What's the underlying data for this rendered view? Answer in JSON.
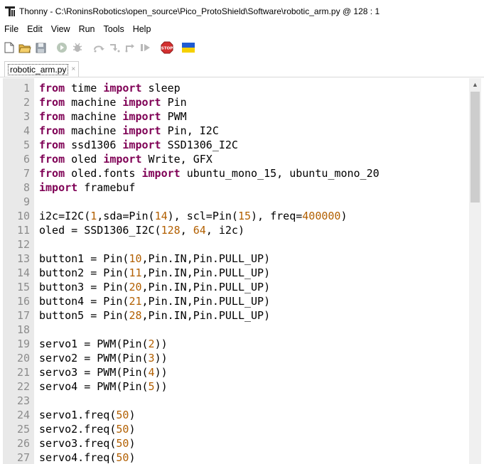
{
  "window": {
    "title": "Thonny  -  C:\\RoninsRobotics\\open_source\\Pico_ProtoShield\\Software\\robotic_arm.py  @  128 : 1"
  },
  "menu": [
    "File",
    "Edit",
    "View",
    "Run",
    "Tools",
    "Help"
  ],
  "toolbar": {
    "icons": [
      "new-file-icon",
      "open-folder-icon",
      "save-icon",
      "run-icon",
      "debug-icon",
      "step-over-icon",
      "step-into-icon",
      "step-out-icon",
      "resume-icon",
      "stop-icon",
      "ukraine-flag-icon"
    ],
    "stop_label": "STOP",
    "colors": {
      "stop": "#d32f2f",
      "flag_blue": "#1f5bd1",
      "flag_yellow": "#f5d000"
    }
  },
  "editor": {
    "tab_label": "robotic_arm.py",
    "tab_close": "×",
    "lines": [
      {
        "n": "1",
        "parts": [
          [
            "kw",
            "from"
          ],
          [
            "t",
            " time "
          ],
          [
            "kw",
            "import"
          ],
          [
            "t",
            " sleep"
          ]
        ]
      },
      {
        "n": "2",
        "parts": [
          [
            "kw",
            "from"
          ],
          [
            "t",
            " machine "
          ],
          [
            "kw",
            "import"
          ],
          [
            "t",
            " Pin"
          ]
        ]
      },
      {
        "n": "3",
        "parts": [
          [
            "kw",
            "from"
          ],
          [
            "t",
            " machine "
          ],
          [
            "kw",
            "import"
          ],
          [
            "t",
            " PWM"
          ]
        ]
      },
      {
        "n": "4",
        "parts": [
          [
            "kw",
            "from"
          ],
          [
            "t",
            " machine "
          ],
          [
            "kw",
            "import"
          ],
          [
            "t",
            " Pin, I2C"
          ]
        ]
      },
      {
        "n": "5",
        "parts": [
          [
            "kw",
            "from"
          ],
          [
            "t",
            " ssd1306 "
          ],
          [
            "kw",
            "import"
          ],
          [
            "t",
            " SSD1306_I2C"
          ]
        ]
      },
      {
        "n": "6",
        "parts": [
          [
            "kw",
            "from"
          ],
          [
            "t",
            " oled "
          ],
          [
            "kw",
            "import"
          ],
          [
            "t",
            " Write, GFX"
          ]
        ]
      },
      {
        "n": "7",
        "parts": [
          [
            "kw",
            "from"
          ],
          [
            "t",
            " oled.fonts "
          ],
          [
            "kw",
            "import"
          ],
          [
            "t",
            " ubuntu_mono_15, ubuntu_mono_20"
          ]
        ]
      },
      {
        "n": "8",
        "parts": [
          [
            "kw",
            "import"
          ],
          [
            "t",
            " framebuf"
          ]
        ]
      },
      {
        "n": "9",
        "parts": []
      },
      {
        "n": "10",
        "parts": [
          [
            "t",
            "i2c=I2C("
          ],
          [
            "num",
            "1"
          ],
          [
            "t",
            ",sda=Pin("
          ],
          [
            "num",
            "14"
          ],
          [
            "t",
            "), scl=Pin("
          ],
          [
            "num",
            "15"
          ],
          [
            "t",
            "), freq="
          ],
          [
            "num",
            "400000"
          ],
          [
            "t",
            ")"
          ]
        ]
      },
      {
        "n": "11",
        "parts": [
          [
            "t",
            "oled = SSD1306_I2C("
          ],
          [
            "num",
            "128"
          ],
          [
            "t",
            ", "
          ],
          [
            "num",
            "64"
          ],
          [
            "t",
            ", i2c)"
          ]
        ]
      },
      {
        "n": "12",
        "parts": []
      },
      {
        "n": "13",
        "parts": [
          [
            "t",
            "button1 = Pin("
          ],
          [
            "num",
            "10"
          ],
          [
            "t",
            ",Pin.IN,Pin.PULL_UP)"
          ]
        ]
      },
      {
        "n": "14",
        "parts": [
          [
            "t",
            "button2 = Pin("
          ],
          [
            "num",
            "11"
          ],
          [
            "t",
            ",Pin.IN,Pin.PULL_UP)"
          ]
        ]
      },
      {
        "n": "15",
        "parts": [
          [
            "t",
            "button3 = Pin("
          ],
          [
            "num",
            "20"
          ],
          [
            "t",
            ",Pin.IN,Pin.PULL_UP)"
          ]
        ]
      },
      {
        "n": "16",
        "parts": [
          [
            "t",
            "button4 = Pin("
          ],
          [
            "num",
            "21"
          ],
          [
            "t",
            ",Pin.IN,Pin.PULL_UP)"
          ]
        ]
      },
      {
        "n": "17",
        "parts": [
          [
            "t",
            "button5 = Pin("
          ],
          [
            "num",
            "28"
          ],
          [
            "t",
            ",Pin.IN,Pin.PULL_UP)"
          ]
        ]
      },
      {
        "n": "18",
        "parts": []
      },
      {
        "n": "19",
        "parts": [
          [
            "t",
            "servo1 = PWM(Pin("
          ],
          [
            "num",
            "2"
          ],
          [
            "t",
            "))"
          ]
        ]
      },
      {
        "n": "20",
        "parts": [
          [
            "t",
            "servo2 = PWM(Pin("
          ],
          [
            "num",
            "3"
          ],
          [
            "t",
            "))"
          ]
        ]
      },
      {
        "n": "21",
        "parts": [
          [
            "t",
            "servo3 = PWM(Pin("
          ],
          [
            "num",
            "4"
          ],
          [
            "t",
            "))"
          ]
        ]
      },
      {
        "n": "22",
        "parts": [
          [
            "t",
            "servo4 = PWM(Pin("
          ],
          [
            "num",
            "5"
          ],
          [
            "t",
            "))"
          ]
        ]
      },
      {
        "n": "23",
        "parts": []
      },
      {
        "n": "24",
        "parts": [
          [
            "t",
            "servo1.freq("
          ],
          [
            "num",
            "50"
          ],
          [
            "t",
            ")"
          ]
        ]
      },
      {
        "n": "25",
        "parts": [
          [
            "t",
            "servo2.freq("
          ],
          [
            "num",
            "50"
          ],
          [
            "t",
            ")"
          ]
        ]
      },
      {
        "n": "26",
        "parts": [
          [
            "t",
            "servo3.freq("
          ],
          [
            "num",
            "50"
          ],
          [
            "t",
            ")"
          ]
        ]
      },
      {
        "n": "27",
        "parts": [
          [
            "t",
            "servo4.freq("
          ],
          [
            "num",
            "50"
          ],
          [
            "t",
            ")"
          ]
        ]
      }
    ]
  },
  "colors": {
    "keyword": "#7f0055",
    "number": "#b25f00",
    "line_number": "#8c8c8c",
    "gutter_bg": "#e9e9e9"
  }
}
